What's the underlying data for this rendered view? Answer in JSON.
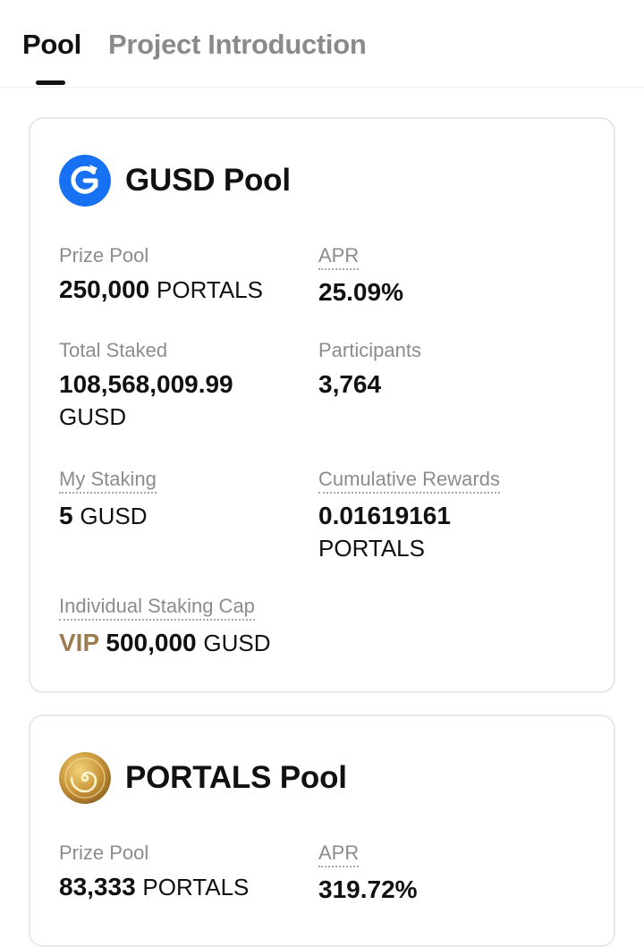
{
  "tabs": [
    {
      "label": "Pool",
      "active": true
    },
    {
      "label": "Project Introduction",
      "active": false
    }
  ],
  "pools": [
    {
      "title": "GUSD Pool",
      "icon": "gusd-coin-icon",
      "prize_pool_label": "Prize Pool",
      "prize_pool_value": "250,000",
      "prize_pool_unit": "PORTALS",
      "apr_label": "APR",
      "apr_value": "25.09%",
      "total_staked_label": "Total Staked",
      "total_staked_value": "108,568,009.99",
      "total_staked_unit": "GUSD",
      "participants_label": "Participants",
      "participants_value": "3,764",
      "my_staking_label": "My Staking",
      "my_staking_value": "5",
      "my_staking_unit": "GUSD",
      "cumulative_rewards_label": "Cumulative Rewards",
      "cumulative_rewards_value": "0.01619161",
      "cumulative_rewards_unit": "PORTALS",
      "cap_label": "Individual Staking Cap",
      "cap_tier": "VIP",
      "cap_value": "500,000",
      "cap_unit": "GUSD"
    },
    {
      "title": "PORTALS Pool",
      "icon": "portals-coin-icon",
      "prize_pool_label": "Prize Pool",
      "prize_pool_value": "83,333",
      "prize_pool_unit": "PORTALS",
      "apr_label": "APR",
      "apr_value": "319.72%"
    }
  ],
  "colors": {
    "gusd_icon": "#1672f3",
    "portals_icon": "#c8943a",
    "vip": "#9b7b4f",
    "label": "#8c8c8c",
    "inactive_tab": "#8a8a8a"
  }
}
